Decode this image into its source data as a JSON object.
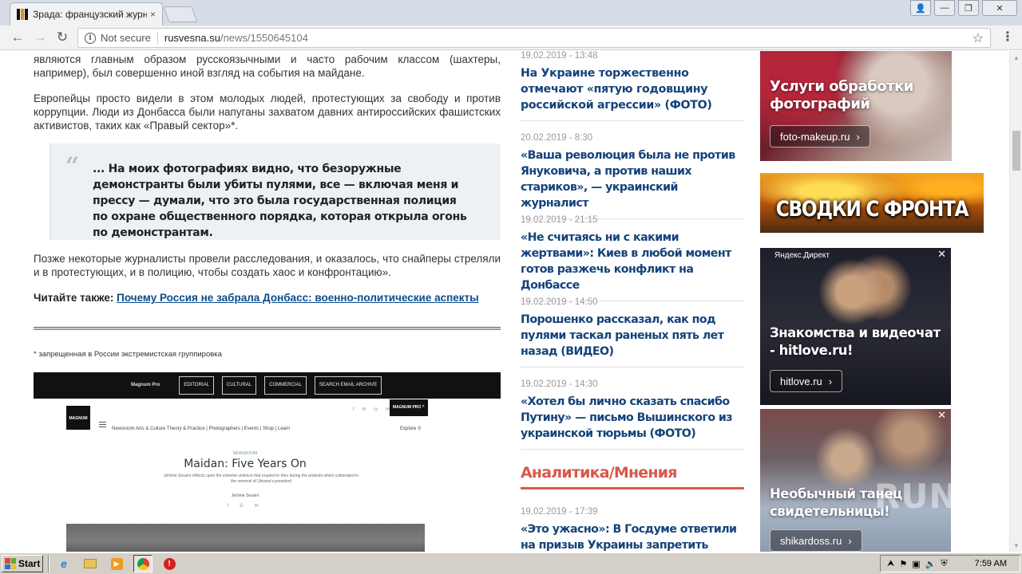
{
  "browser": {
    "tab_title": "Зрада: французский журн",
    "tab_close": "×",
    "window_buttons": [
      "👤",
      "—",
      "❐",
      "✕"
    ],
    "nav": {
      "back": "←",
      "forward": "→",
      "reload": "↻"
    },
    "omnibox": {
      "security_label": "Not secure",
      "host": "rusvesna.su",
      "path": "/news/1550645104"
    },
    "bookmark_icon": "star-icon",
    "menu_icon": "⋮"
  },
  "article": {
    "paragraph1": "являются главным образом русскоязычными и часто рабочим классом (шахтеры, например), был совершенно иной взгляд на события на майдане.",
    "paragraph2": "Европейцы просто видели в этом молодых людей, протестующих за свободу и против коррупции. Люди из Донбасса были напуганы захватом давних антироссийских фашистских активистов, таких как «Правый сектор»*.",
    "quote_mark": "“",
    "quote": "... На моих фотографиях видно, что безоружные демонстранты были убиты пулями, все — включая меня и прессу — думали, что это была государственная полиция по охране общественного порядка, которая открыла огонь по демонстрантам.",
    "paragraph3": "Позже некоторые журналисты провели расследования, и оказалось, что снайперы стреляли и в протестующих, и в полицию, чтобы создать хаос и конфронтацию».",
    "read_also_label": "Читайте также:",
    "read_also_link": "Почему Россия не забрала Донбасс: военно-политические аспекты",
    "footnote": "* запрещенная в России экстремистская группировка",
    "embed": {
      "brand": "Magnum Pro",
      "chips": [
        "EDITORIAL",
        "CULTURAL",
        "COMMERCIAL",
        "SEARCH EMAIL ARCHIVE"
      ],
      "logo": "MAGNUM",
      "nav": "Newsroom   Arts & Culture   Theory & Practice  |  Photographers  |  Events  |  Shop  |  Learn",
      "social": "f ✉ ◎ ✉",
      "pro_badge": "MAGNUM PRO ^",
      "explore": "Explore  ⚲",
      "kicker": "NEWSROOM",
      "title": "Maidan: Five Years On",
      "subtitle": "Jérôme Sessini reflects upon the extreme violence that erupted in Kiev during the protests which culminated in the removal of Ukraine's president",
      "author": "Jérôme Sessini",
      "shares": "f ✆ ✉"
    }
  },
  "news": {
    "items": [
      {
        "date": "19.02.2019 - 13:48",
        "title": "На Украине торжественно отмечают «пятую годовщину российской агрессии» (ФОТО)",
        "weight": "bold"
      },
      {
        "date": "20.02.2019 - 8:30",
        "title": "«Ваша революция была не против Януковича, а против наших стариков», — украинский журналист",
        "weight": "light"
      },
      {
        "date": "19.02.2019 - 21:15",
        "title": "«Не считаясь ни с какими жертвами»: Киев в любой момент готов разжечь конфликт на Донбассе",
        "weight": "bold"
      },
      {
        "date": "19.02.2019 - 14:50",
        "title": "Порошенко рассказал, как под пулями таскал раненых пять лет назад (ВИДЕО)",
        "weight": "light"
      },
      {
        "date": "19.02.2019 - 14:30",
        "title": "«Хотел бы лично сказать спасибо Путину» — письмо Вышинского из украинской тюрьмы (ФОТО)",
        "weight": "light"
      }
    ],
    "section_title": "Аналитика/Мнения",
    "analytics": [
      {
        "date": "19.02.2019 - 17:39",
        "title": "«Это ужасно»: В Госдуме ответили на призыв Украины запретить показ"
      }
    ]
  },
  "ads": {
    "photo": {
      "headline": "Услуги обработки фотографий",
      "button": "foto-makeup.ru",
      "arrow": "›"
    },
    "front": {
      "headline": "СВОДКИ С ФРОНТА"
    },
    "dating": {
      "label": "Яндекс.Директ",
      "close": "✕",
      "headline": "Знакомства и видеочат - hitlove.ru!",
      "button": "hitlove.ru",
      "arrow": "›"
    },
    "dance": {
      "close": "✕",
      "headline": "Необычный танец свидетельницы!",
      "button": "shikardoss.ru",
      "arrow": "›"
    },
    "watermark": "RUN"
  },
  "scrollbar": {
    "up": "▲",
    "down": "▼"
  },
  "taskbar": {
    "start_label": "Start",
    "quick_launch": [
      "ie-icon",
      "folder-icon",
      "media-player-icon",
      "chrome-icon",
      "stop-icon"
    ],
    "tray_arrow": "⮝",
    "clock": "7:59 AM"
  },
  "colors": {
    "link": "#14437b",
    "section_accent": "#d9584b",
    "date": "#999999"
  }
}
